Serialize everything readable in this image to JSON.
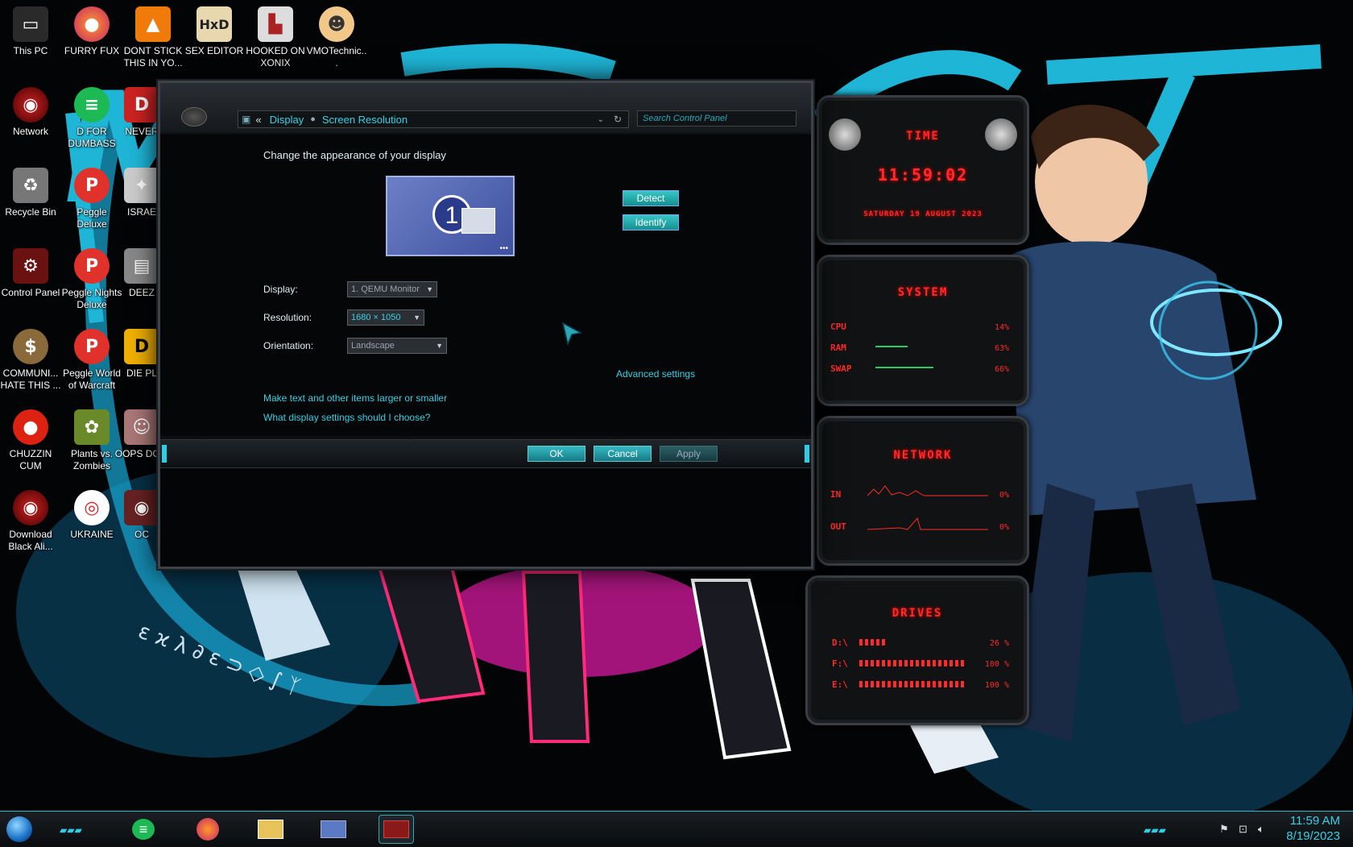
{
  "desktop": {
    "icons": [
      {
        "label": "This PC",
        "icon": "pc-icon"
      },
      {
        "label": "FURRY FUX",
        "icon": "firefox-icon"
      },
      {
        "label": "DONT STICK THIS IN YO...",
        "icon": "vlc-icon"
      },
      {
        "label": "SEX EDITOR",
        "icon": "hxd-icon"
      },
      {
        "label": "HOOKED ON XONIX",
        "icon": "game-icon"
      },
      {
        "label": "VMOTechnic...",
        "icon": "doctor-icon"
      },
      {
        "label": "Network",
        "icon": "network-icon"
      },
      {
        "label": "D FOR DUMBASS",
        "icon": "spotify-like-icon"
      },
      {
        "label": "NEVER",
        "icon": "app-icon"
      },
      {
        "label": "Recycle Bin",
        "icon": "recycle-bin-icon"
      },
      {
        "label": "Peggle Deluxe",
        "icon": "peggle-icon"
      },
      {
        "label": "ISRAE",
        "icon": "app-icon"
      },
      {
        "label": "Control Panel",
        "icon": "control-panel-icon"
      },
      {
        "label": "Peggle Nights Deluxe",
        "icon": "peggle-icon"
      },
      {
        "label": "DEEZ",
        "icon": "printer-icon"
      },
      {
        "label": "COMMUNI... HATE THIS ...",
        "icon": "moneybag-icon"
      },
      {
        "label": "Peggle World of Warcraft",
        "icon": "peggle-icon"
      },
      {
        "label": "DIE PL",
        "icon": "app-icon"
      },
      {
        "label": "CHUZZIN CUM",
        "icon": "chuzzle-icon"
      },
      {
        "label": "Plants vs. Zombies",
        "icon": "pvz-icon"
      },
      {
        "label": "OOPS DO T",
        "icon": "portrait-icon"
      },
      {
        "label": "Download Black Ali...",
        "icon": "alien-icon"
      },
      {
        "label": "UKRAINE",
        "icon": "lifebuoy-icon"
      },
      {
        "label": "OC",
        "icon": "app-icon"
      }
    ]
  },
  "window": {
    "breadcrumb": {
      "back": "«",
      "items": [
        "Display",
        "Screen Resolution"
      ]
    },
    "search_placeholder": "Search Control Panel",
    "heading": "Change the appearance of your display",
    "monitor_number": "1",
    "detect_label": "Detect",
    "identify_label": "Identify",
    "display_label": "Display:",
    "display_value": "1. QEMU Monitor",
    "resolution_label": "Resolution:",
    "resolution_value": "1680 × 1050",
    "orientation_label": "Orientation:",
    "orientation_value": "Landscape",
    "advanced_link": "Advanced settings",
    "link_text_size": "Make text and other items larger or smaller",
    "link_help": "What display settings should I choose?",
    "ok_label": "OK",
    "cancel_label": "Cancel",
    "apply_label": "Apply"
  },
  "gadgets": {
    "time": {
      "title": "TIME",
      "time": "11:59:02",
      "date": "SATURDAY 19 AUGUST 2023"
    },
    "system": {
      "title": "SYSTEM",
      "rows": [
        {
          "name": "CPU",
          "value": "14%"
        },
        {
          "name": "RAM",
          "value": "63%"
        },
        {
          "name": "SWAP",
          "value": "66%"
        }
      ]
    },
    "network": {
      "title": "NETWORK",
      "rows": [
        {
          "name": "IN",
          "value": "0%"
        },
        {
          "name": "OUT",
          "value": "0%"
        }
      ]
    },
    "drives": {
      "title": "DRIVES",
      "rows": [
        {
          "name": "D:\\",
          "value": "26 %"
        },
        {
          "name": "F:\\",
          "value": "100 %"
        },
        {
          "name": "E:\\",
          "value": "100 %"
        }
      ]
    }
  },
  "taskbar": {
    "clock_time": "11:59 AM",
    "clock_date": "8/19/2023",
    "apps": [
      "notes-icon",
      "firefox-icon",
      "file-explorer-icon",
      "control-panel-icon",
      "display-settings-icon"
    ]
  },
  "colors": {
    "accent": "#37d0e6",
    "gadget_red": "#ff2a2a"
  }
}
